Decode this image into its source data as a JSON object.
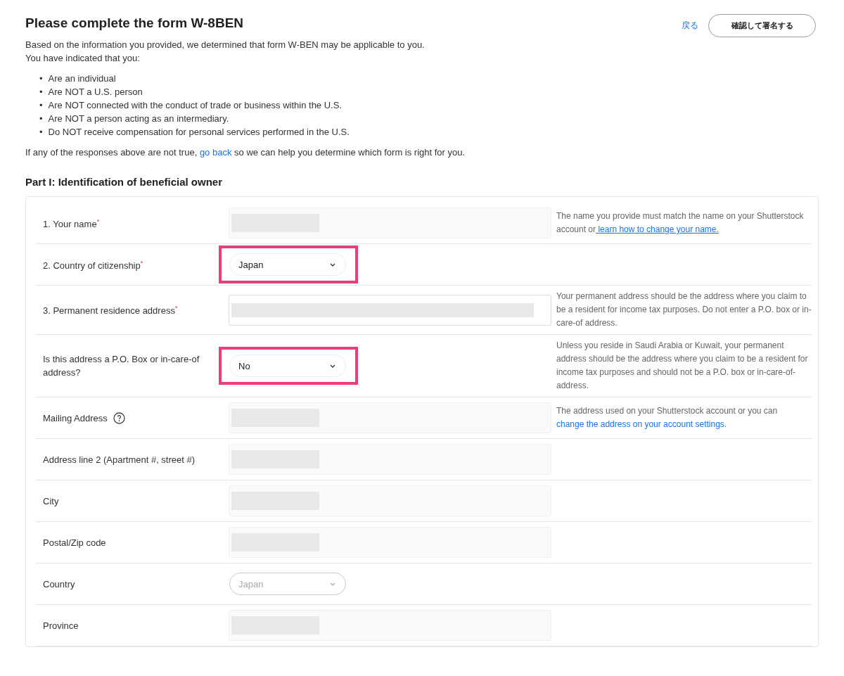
{
  "header": {
    "title": "Please complete the form W-8BEN",
    "back_link": "戻る",
    "confirm_button": "確認して署名する"
  },
  "intro": [
    "Based on the information you provided, we determined that form W-BEN may be applicable to you.",
    "You have indicated that you:"
  ],
  "bullet_marker": "•",
  "bullets": [
    "Are an individual",
    "Are NOT a U.S. person",
    "Are NOT connected with the conduct of trade or business within the U.S.",
    "Are NOT a person acting as an intermediary.",
    "Do NOT receive compensation for personal services performed in the U.S."
  ],
  "note": {
    "before": "If any of the responses above are not true, ",
    "link": "go back",
    "after": " so we can help you determine which form is right for you."
  },
  "section_title": "Part I: Identification of beneficial owner",
  "rows": [
    {
      "kind": "text",
      "label": "1. Your name",
      "mark": "*",
      "help": {
        "text": "The name you provide must match the name on your Shutterstock account or",
        "link": " learn how to change your name.",
        "underline": true
      }
    },
    {
      "kind": "select",
      "label": "2. Country of citizenship",
      "mark": "*",
      "value": "Japan",
      "highlighted": true,
      "disabled": false
    },
    {
      "kind": "wide",
      "label": "3. Permanent residence address",
      "mark": "*",
      "help": {
        "text": "Your permanent address should be the address where you claim to be a resident for income tax purposes. Do not enter a P.O. box or in-care-of address."
      }
    },
    {
      "kind": "select",
      "label": "Is this address a P.O. Box or in-care-of address?",
      "value": "No",
      "highlighted": true,
      "disabled": false,
      "help": {
        "text": "Unless you reside in Saudi Arabia or Kuwait, your permanent address should be the address where you claim to be a resident for income tax purposes and should not be a P.O. box or in-care-of-address."
      }
    },
    {
      "kind": "text",
      "label": "Mailing Address",
      "info": true,
      "help": {
        "text": "The address used on your Shutterstock account or you can ",
        "link": "change the address on your account settings.",
        "underline": false
      }
    },
    {
      "kind": "text",
      "label": "Address line 2 (Apartment #, street #)"
    },
    {
      "kind": "text",
      "label": "City"
    },
    {
      "kind": "text",
      "label": "Postal/Zip code"
    },
    {
      "kind": "select",
      "label": "Country",
      "value": "Japan",
      "highlighted": false,
      "disabled": true
    },
    {
      "kind": "text",
      "label": "Province"
    }
  ]
}
